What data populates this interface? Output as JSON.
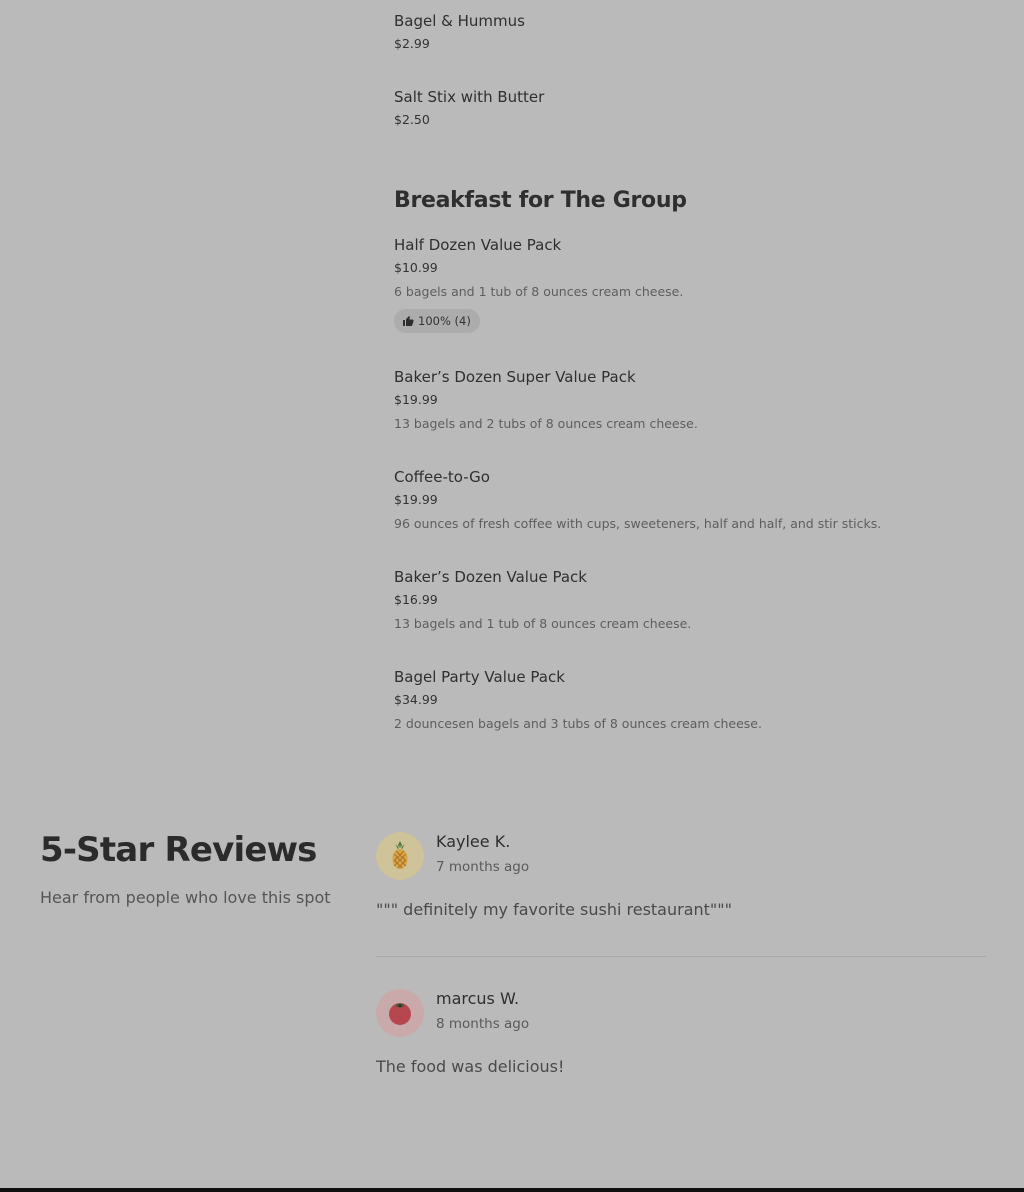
{
  "menu": {
    "items_top": [
      {
        "name": "Bagel & Hummus",
        "price": "$2.99"
      },
      {
        "name": "Salt Stix with Butter",
        "price": "$2.50"
      }
    ],
    "section_title": "Breakfast for The Group",
    "group_items": [
      {
        "name": "Half Dozen Value Pack",
        "price": "$10.99",
        "description": "6 bagels and 1 tub of 8 ounces cream cheese.",
        "badge": "100% (4)"
      },
      {
        "name": "Baker’s Dozen Super Value Pack",
        "price": "$19.99",
        "description": "13 bagels and 2 tubs of 8 ounces cream cheese."
      },
      {
        "name": "Coffee-to-Go",
        "price": "$19.99",
        "description": "96 ounces of fresh coffee with cups, sweeteners, half and half, and stir sticks."
      },
      {
        "name": "Baker’s Dozen Value Pack",
        "price": "$16.99",
        "description": "13 bagels and 1 tub of 8 ounces cream cheese."
      },
      {
        "name": "Bagel Party Value Pack",
        "price": "$34.99",
        "description": "2 douncesen bagels and 3 tubs of 8 ounces cream cheese."
      }
    ]
  },
  "reviews": {
    "title": "5-Star Reviews",
    "subtitle": "Hear from people who love this spot",
    "items": [
      {
        "name": "Kaylee K.",
        "time": "7 months ago",
        "text": "\"\"\" definitely my favorite sushi restaurant\"\"\"",
        "avatar_icon": "pineapple-icon"
      },
      {
        "name": "marcus W.",
        "time": "8 months ago",
        "text": "The food was delicious!",
        "avatar_icon": "tomato-icon"
      }
    ]
  },
  "icons": {
    "badge_icon": "thumbs-up-icon"
  }
}
